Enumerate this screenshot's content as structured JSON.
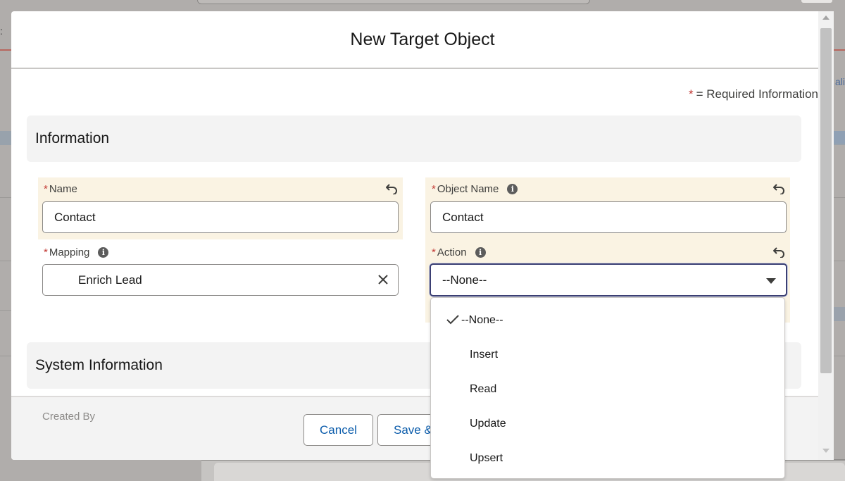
{
  "modal": {
    "title": "New Target Object",
    "required_star": "*",
    "required_note": "= Required Information"
  },
  "sections": {
    "information": "Information",
    "system_information": "System Information"
  },
  "fields": {
    "name": {
      "required": "*",
      "label": "Name",
      "value": "Contact"
    },
    "object_name": {
      "required": "*",
      "label": "Object Name",
      "value": "Contact"
    },
    "mapping": {
      "required": "*",
      "label": "Mapping",
      "value": "Enrich Lead"
    },
    "action": {
      "required": "*",
      "label": "Action",
      "value": "--None--"
    }
  },
  "info_icon_glyph": "i",
  "dropdown": {
    "selected": "--None--",
    "options": [
      "--None--",
      "Insert",
      "Read",
      "Update",
      "Upsert"
    ]
  },
  "footer": {
    "cancel_label": "Cancel",
    "save_new_label": "Save &"
  },
  "background": {
    "created_by": "Created By",
    "right_link_fragment": "ali"
  },
  "colors": {
    "required": "#c23934",
    "field_highlight": "#faf3e3",
    "focus_border": "#3b3f73",
    "button_text": "#0b5cab"
  },
  "icons": [
    "undo-icon",
    "info-icon",
    "close-icon",
    "chevron-down-icon",
    "checkmark-icon"
  ]
}
